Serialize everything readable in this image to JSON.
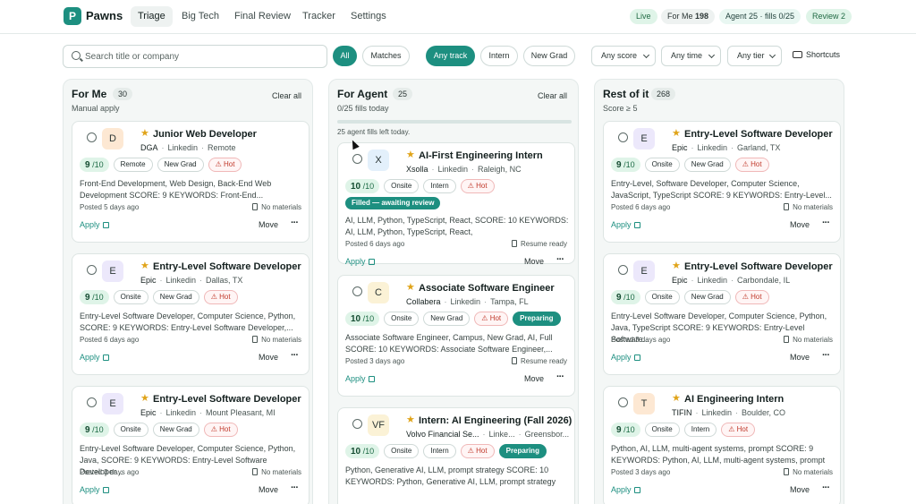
{
  "app": {
    "logo_letter": "P",
    "name": "Pawns"
  },
  "nav": {
    "items": [
      "Triage",
      "Big Tech",
      "Final Review",
      "Tracker",
      "Settings"
    ]
  },
  "status": {
    "live": "Live",
    "for_me_label": "For Me",
    "for_me_count": "198",
    "agent_label": "Agent 25 · fills 0/25",
    "review_label": "Review 2"
  },
  "search": {
    "placeholder": "Search title or company",
    "value": ""
  },
  "filters": {
    "all": "All",
    "matches": "Matches",
    "any_track": "Any track",
    "intern": "Intern",
    "new_grad": "New Grad",
    "score": "Any score",
    "time": "Any time",
    "tier": "Any tier",
    "shortcuts": "Shortcuts"
  },
  "columns": [
    {
      "title": "For Me",
      "count": "30",
      "subtitle": "Manual apply",
      "clear": "Clear all",
      "cards": [
        {
          "avatar": "D",
          "avatar_color": "#fde8d3",
          "title": "Junior Web Developer",
          "company": "DGA",
          "source": "Linkedin",
          "location": "Remote",
          "score": "9",
          "score_den": "/10",
          "tags": [
            "Remote",
            "New Grad"
          ],
          "hot": "Hot",
          "desc": "Front-End Development, Web Design, Back-End Web Development SCORE: 9 KEYWORDS: Front-End...",
          "posted": "Posted 5 days ago",
          "materials": "No materials",
          "apply": "Apply",
          "move": "Move"
        },
        {
          "avatar": "E",
          "avatar_color": "#ece8fb",
          "title": "Entry-Level Software Developer",
          "company": "Epic",
          "source": "Linkedin",
          "location": "Dallas, TX",
          "score": "9",
          "score_den": "/10",
          "tags": [
            "Onsite",
            "New Grad"
          ],
          "hot": "Hot",
          "desc": "Entry-Level Software Developer, Computer Science, Python, SCORE: 9 KEYWORDS: Entry-Level Software Developer,...",
          "posted": "Posted 6 days ago",
          "materials": "No materials",
          "apply": "Apply",
          "move": "Move"
        },
        {
          "avatar": "E",
          "avatar_color": "#ece8fb",
          "title": "Entry-Level Software Developer",
          "company": "Epic",
          "source": "Linkedin",
          "location": "Mount Pleasant, MI",
          "score": "9",
          "score_den": "/10",
          "tags": [
            "Onsite",
            "New Grad"
          ],
          "hot": "Hot",
          "desc": "Entry-Level Software Developer, Computer Science, Python, Java, SCORE: 9 KEYWORDS: Entry-Level Software Developer...",
          "posted": "Posted 3 days ago",
          "materials": "No materials",
          "apply": "Apply",
          "move": "Move"
        }
      ]
    },
    {
      "title": "For Agent",
      "count": "25",
      "subtitle": "0/25 fills today",
      "clear": "Clear all",
      "progress": 0.0,
      "fills_left": "25 agent fills left today.",
      "cards": [
        {
          "avatar": "X",
          "avatar_color": "#e3f0fb",
          "title": "AI-First Engineering Intern",
          "company": "Xsolla",
          "source": "Linkedin",
          "location": "Raleigh, NC",
          "score": "10",
          "score_den": "/10",
          "tags": [
            "Onsite",
            "Intern"
          ],
          "hot": "Hot",
          "banner": "Filled — awaiting review",
          "desc": "AI, LLM, Python, TypeScript, React, SCORE: 10 KEYWORDS: AI, LLM, Python, TypeScript, React,",
          "posted": "Posted 6 days ago",
          "materials": "Resume ready",
          "apply": "Apply",
          "move": "Move"
        },
        {
          "avatar": "C",
          "avatar_color": "#fbf2d6",
          "title": "Associate Software Engineer",
          "company": "Collabera",
          "source": "Linkedin",
          "location": "Tampa, FL",
          "score": "10",
          "score_den": "/10",
          "tags": [
            "Onsite",
            "New Grad"
          ],
          "hot": "Hot",
          "status": "Preparing",
          "desc": "Associate Software Engineer, Campus, New Grad, AI, Full SCORE: 10 KEYWORDS: Associate Software Engineer,...",
          "posted": "Posted 3 days ago",
          "materials": "Resume ready",
          "apply": "Apply",
          "move": "Move"
        },
        {
          "avatar": "VF",
          "avatar_color": "#fbf2d6",
          "title": "Intern: AI Engineering (Fall 2026)",
          "company": "Volvo Financial Se...",
          "source": "Linke...",
          "location": "Greensbor...",
          "score": "10",
          "score_den": "/10",
          "tags": [
            "Onsite",
            "Intern"
          ],
          "hot": "Hot",
          "status": "Preparing",
          "desc": "Python, Generative AI, LLM, prompt strategy SCORE: 10 KEYWORDS: Python, Generative AI, LLM, prompt strategy",
          "posted": "",
          "materials": "",
          "apply": "",
          "move": ""
        }
      ]
    },
    {
      "title": "Rest of it",
      "count": "268",
      "subtitle": "Score ≥ 5",
      "clear": "",
      "cards": [
        {
          "avatar": "E",
          "avatar_color": "#ece8fb",
          "title": "Entry-Level Software Developer",
          "company": "Epic",
          "source": "Linkedin",
          "location": "Garland, TX",
          "score": "9",
          "score_den": "/10",
          "tags": [
            "Onsite",
            "New Grad"
          ],
          "hot": "Hot",
          "desc": "Entry-Level, Software Developer, Computer Science, JavaScript, TypeScript SCORE: 9 KEYWORDS: Entry-Level...",
          "posted": "Posted 6 days ago",
          "materials": "No materials",
          "apply": "Apply",
          "move": "Move"
        },
        {
          "avatar": "E",
          "avatar_color": "#ece8fb",
          "title": "Entry-Level Software Developer",
          "company": "Epic",
          "source": "Linkedin",
          "location": "Carbondale, IL",
          "score": "9",
          "score_den": "/10",
          "tags": [
            "Onsite",
            "New Grad"
          ],
          "hot": "Hot",
          "desc": "Entry-Level Software Developer, Computer Science, Python, Java, TypeScript SCORE: 9 KEYWORDS: Entry-Level Software...",
          "posted": "Posted 3 days ago",
          "materials": "No materials",
          "apply": "Apply",
          "move": "Move"
        },
        {
          "avatar": "T",
          "avatar_color": "#fde8d3",
          "title": "AI Engineering Intern",
          "company": "TIFIN",
          "source": "Linkedin",
          "location": "Boulder, CO",
          "score": "9",
          "score_den": "/10",
          "tags": [
            "Onsite",
            "Intern"
          ],
          "hot": "Hot",
          "desc": "Python, AI, LLM, multi-agent systems, prompt SCORE: 9 KEYWORDS: Python, AI, LLM, multi-agent systems, prompt",
          "posted": "Posted 3 days ago",
          "materials": "No materials",
          "apply": "Apply",
          "move": "Move"
        }
      ]
    }
  ]
}
